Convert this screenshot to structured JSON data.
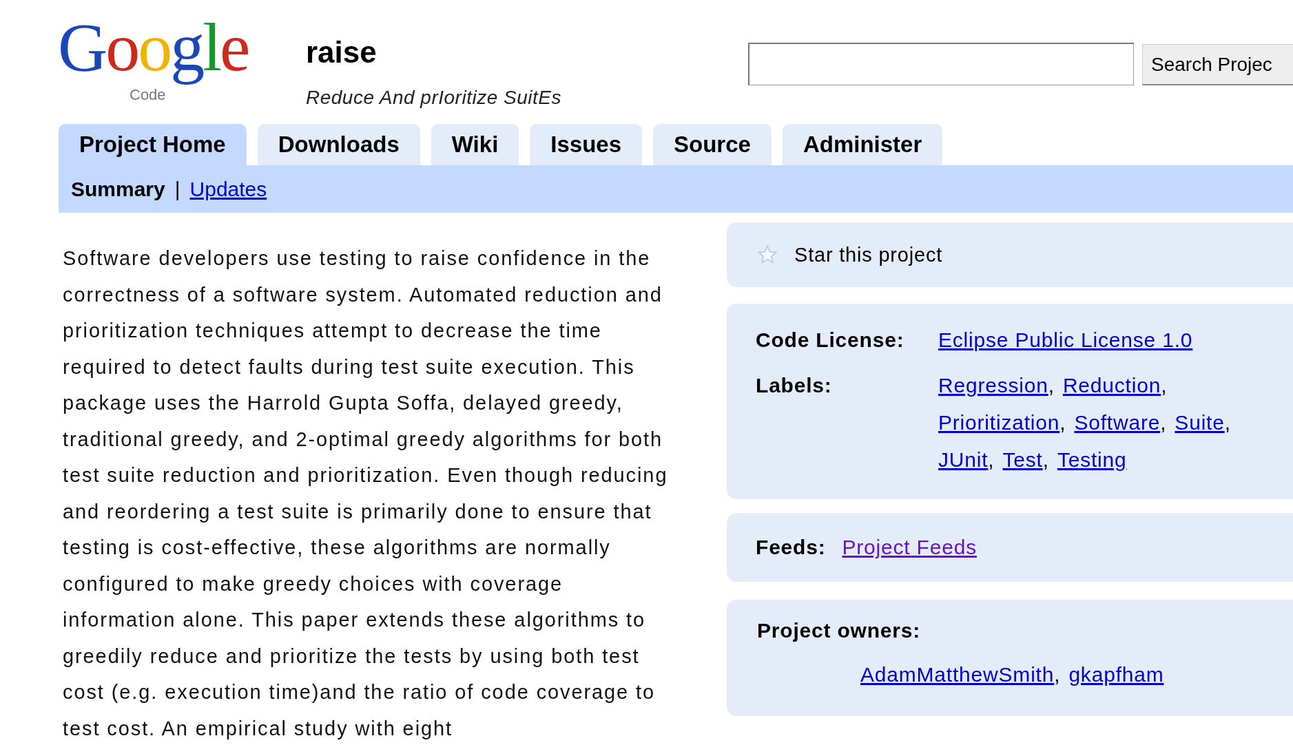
{
  "logo": {
    "wordmark": "Google",
    "product": "Code"
  },
  "project": {
    "name": "raise",
    "summary": "Reduce And prIoritize SuitEs"
  },
  "search": {
    "button": "Search Projec"
  },
  "tabs": [
    {
      "label": "Project Home",
      "selected": true
    },
    {
      "label": "Downloads",
      "selected": false
    },
    {
      "label": "Wiki",
      "selected": false
    },
    {
      "label": "Issues",
      "selected": false
    },
    {
      "label": "Source",
      "selected": false
    },
    {
      "label": "Administer",
      "selected": false
    }
  ],
  "subtabs": {
    "separator": "|",
    "items": [
      {
        "label": "Summary",
        "selected": true
      },
      {
        "label": "Updates",
        "selected": false
      }
    ]
  },
  "description": "Software developers use testing to raise confidence in the correctness of a software system. Automated reduction and prioritization techniques attempt to decrease the time required to detect faults during test suite execution. This package uses the Harrold Gupta Soffa, delayed greedy, traditional greedy, and 2-optimal greedy algorithms for both test suite reduction and prioritization. Even though reducing and reordering a test suite is primarily done to ensure that testing is cost-effective, these algorithms are normally configured to make greedy choices with coverage information alone. This paper extends these algorithms to greedily reduce and prioritize the tests by using both test cost (e.g. execution time)and the ratio of code coverage to test cost. An empirical study with eight",
  "star": {
    "label": "Star this project",
    "starred": false
  },
  "license": {
    "label": "Code License:",
    "value": "Eclipse Public License 1.0"
  },
  "labels": {
    "label": "Labels:",
    "separator": ",",
    "items": [
      "Regression",
      "Reduction",
      "Prioritization",
      "Software",
      "Suite",
      "JUnit",
      "Test",
      "Testing"
    ]
  },
  "feeds": {
    "label": "Feeds:",
    "link": "Project Feeds",
    "visited": true
  },
  "owners": {
    "label": "Project owners:",
    "separator": ",",
    "items": [
      "AdamMatthewSmith",
      "gkapfham"
    ]
  }
}
